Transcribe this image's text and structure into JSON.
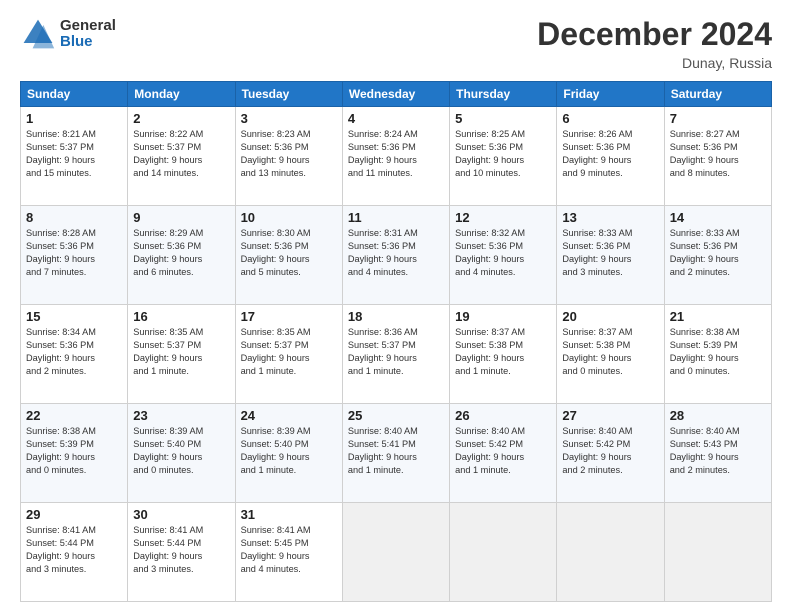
{
  "header": {
    "logo_general": "General",
    "logo_blue": "Blue",
    "month_title": "December 2024",
    "location": "Dunay, Russia"
  },
  "days_of_week": [
    "Sunday",
    "Monday",
    "Tuesday",
    "Wednesday",
    "Thursday",
    "Friday",
    "Saturday"
  ],
  "weeks": [
    [
      {
        "day": "1",
        "detail": "Sunrise: 8:21 AM\nSunset: 5:37 PM\nDaylight: 9 hours\nand 15 minutes."
      },
      {
        "day": "2",
        "detail": "Sunrise: 8:22 AM\nSunset: 5:37 PM\nDaylight: 9 hours\nand 14 minutes."
      },
      {
        "day": "3",
        "detail": "Sunrise: 8:23 AM\nSunset: 5:36 PM\nDaylight: 9 hours\nand 13 minutes."
      },
      {
        "day": "4",
        "detail": "Sunrise: 8:24 AM\nSunset: 5:36 PM\nDaylight: 9 hours\nand 11 minutes."
      },
      {
        "day": "5",
        "detail": "Sunrise: 8:25 AM\nSunset: 5:36 PM\nDaylight: 9 hours\nand 10 minutes."
      },
      {
        "day": "6",
        "detail": "Sunrise: 8:26 AM\nSunset: 5:36 PM\nDaylight: 9 hours\nand 9 minutes."
      },
      {
        "day": "7",
        "detail": "Sunrise: 8:27 AM\nSunset: 5:36 PM\nDaylight: 9 hours\nand 8 minutes."
      }
    ],
    [
      {
        "day": "8",
        "detail": "Sunrise: 8:28 AM\nSunset: 5:36 PM\nDaylight: 9 hours\nand 7 minutes."
      },
      {
        "day": "9",
        "detail": "Sunrise: 8:29 AM\nSunset: 5:36 PM\nDaylight: 9 hours\nand 6 minutes."
      },
      {
        "day": "10",
        "detail": "Sunrise: 8:30 AM\nSunset: 5:36 PM\nDaylight: 9 hours\nand 5 minutes."
      },
      {
        "day": "11",
        "detail": "Sunrise: 8:31 AM\nSunset: 5:36 PM\nDaylight: 9 hours\nand 4 minutes."
      },
      {
        "day": "12",
        "detail": "Sunrise: 8:32 AM\nSunset: 5:36 PM\nDaylight: 9 hours\nand 4 minutes."
      },
      {
        "day": "13",
        "detail": "Sunrise: 8:33 AM\nSunset: 5:36 PM\nDaylight: 9 hours\nand 3 minutes."
      },
      {
        "day": "14",
        "detail": "Sunrise: 8:33 AM\nSunset: 5:36 PM\nDaylight: 9 hours\nand 2 minutes."
      }
    ],
    [
      {
        "day": "15",
        "detail": "Sunrise: 8:34 AM\nSunset: 5:36 PM\nDaylight: 9 hours\nand 2 minutes."
      },
      {
        "day": "16",
        "detail": "Sunrise: 8:35 AM\nSunset: 5:37 PM\nDaylight: 9 hours\nand 1 minute."
      },
      {
        "day": "17",
        "detail": "Sunrise: 8:35 AM\nSunset: 5:37 PM\nDaylight: 9 hours\nand 1 minute."
      },
      {
        "day": "18",
        "detail": "Sunrise: 8:36 AM\nSunset: 5:37 PM\nDaylight: 9 hours\nand 1 minute."
      },
      {
        "day": "19",
        "detail": "Sunrise: 8:37 AM\nSunset: 5:38 PM\nDaylight: 9 hours\nand 1 minute."
      },
      {
        "day": "20",
        "detail": "Sunrise: 8:37 AM\nSunset: 5:38 PM\nDaylight: 9 hours\nand 0 minutes."
      },
      {
        "day": "21",
        "detail": "Sunrise: 8:38 AM\nSunset: 5:39 PM\nDaylight: 9 hours\nand 0 minutes."
      }
    ],
    [
      {
        "day": "22",
        "detail": "Sunrise: 8:38 AM\nSunset: 5:39 PM\nDaylight: 9 hours\nand 0 minutes."
      },
      {
        "day": "23",
        "detail": "Sunrise: 8:39 AM\nSunset: 5:40 PM\nDaylight: 9 hours\nand 0 minutes."
      },
      {
        "day": "24",
        "detail": "Sunrise: 8:39 AM\nSunset: 5:40 PM\nDaylight: 9 hours\nand 1 minute."
      },
      {
        "day": "25",
        "detail": "Sunrise: 8:40 AM\nSunset: 5:41 PM\nDaylight: 9 hours\nand 1 minute."
      },
      {
        "day": "26",
        "detail": "Sunrise: 8:40 AM\nSunset: 5:42 PM\nDaylight: 9 hours\nand 1 minute."
      },
      {
        "day": "27",
        "detail": "Sunrise: 8:40 AM\nSunset: 5:42 PM\nDaylight: 9 hours\nand 2 minutes."
      },
      {
        "day": "28",
        "detail": "Sunrise: 8:40 AM\nSunset: 5:43 PM\nDaylight: 9 hours\nand 2 minutes."
      }
    ],
    [
      {
        "day": "29",
        "detail": "Sunrise: 8:41 AM\nSunset: 5:44 PM\nDaylight: 9 hours\nand 3 minutes."
      },
      {
        "day": "30",
        "detail": "Sunrise: 8:41 AM\nSunset: 5:44 PM\nDaylight: 9 hours\nand 3 minutes."
      },
      {
        "day": "31",
        "detail": "Sunrise: 8:41 AM\nSunset: 5:45 PM\nDaylight: 9 hours\nand 4 minutes."
      },
      {
        "day": "",
        "detail": ""
      },
      {
        "day": "",
        "detail": ""
      },
      {
        "day": "",
        "detail": ""
      },
      {
        "day": "",
        "detail": ""
      }
    ]
  ]
}
